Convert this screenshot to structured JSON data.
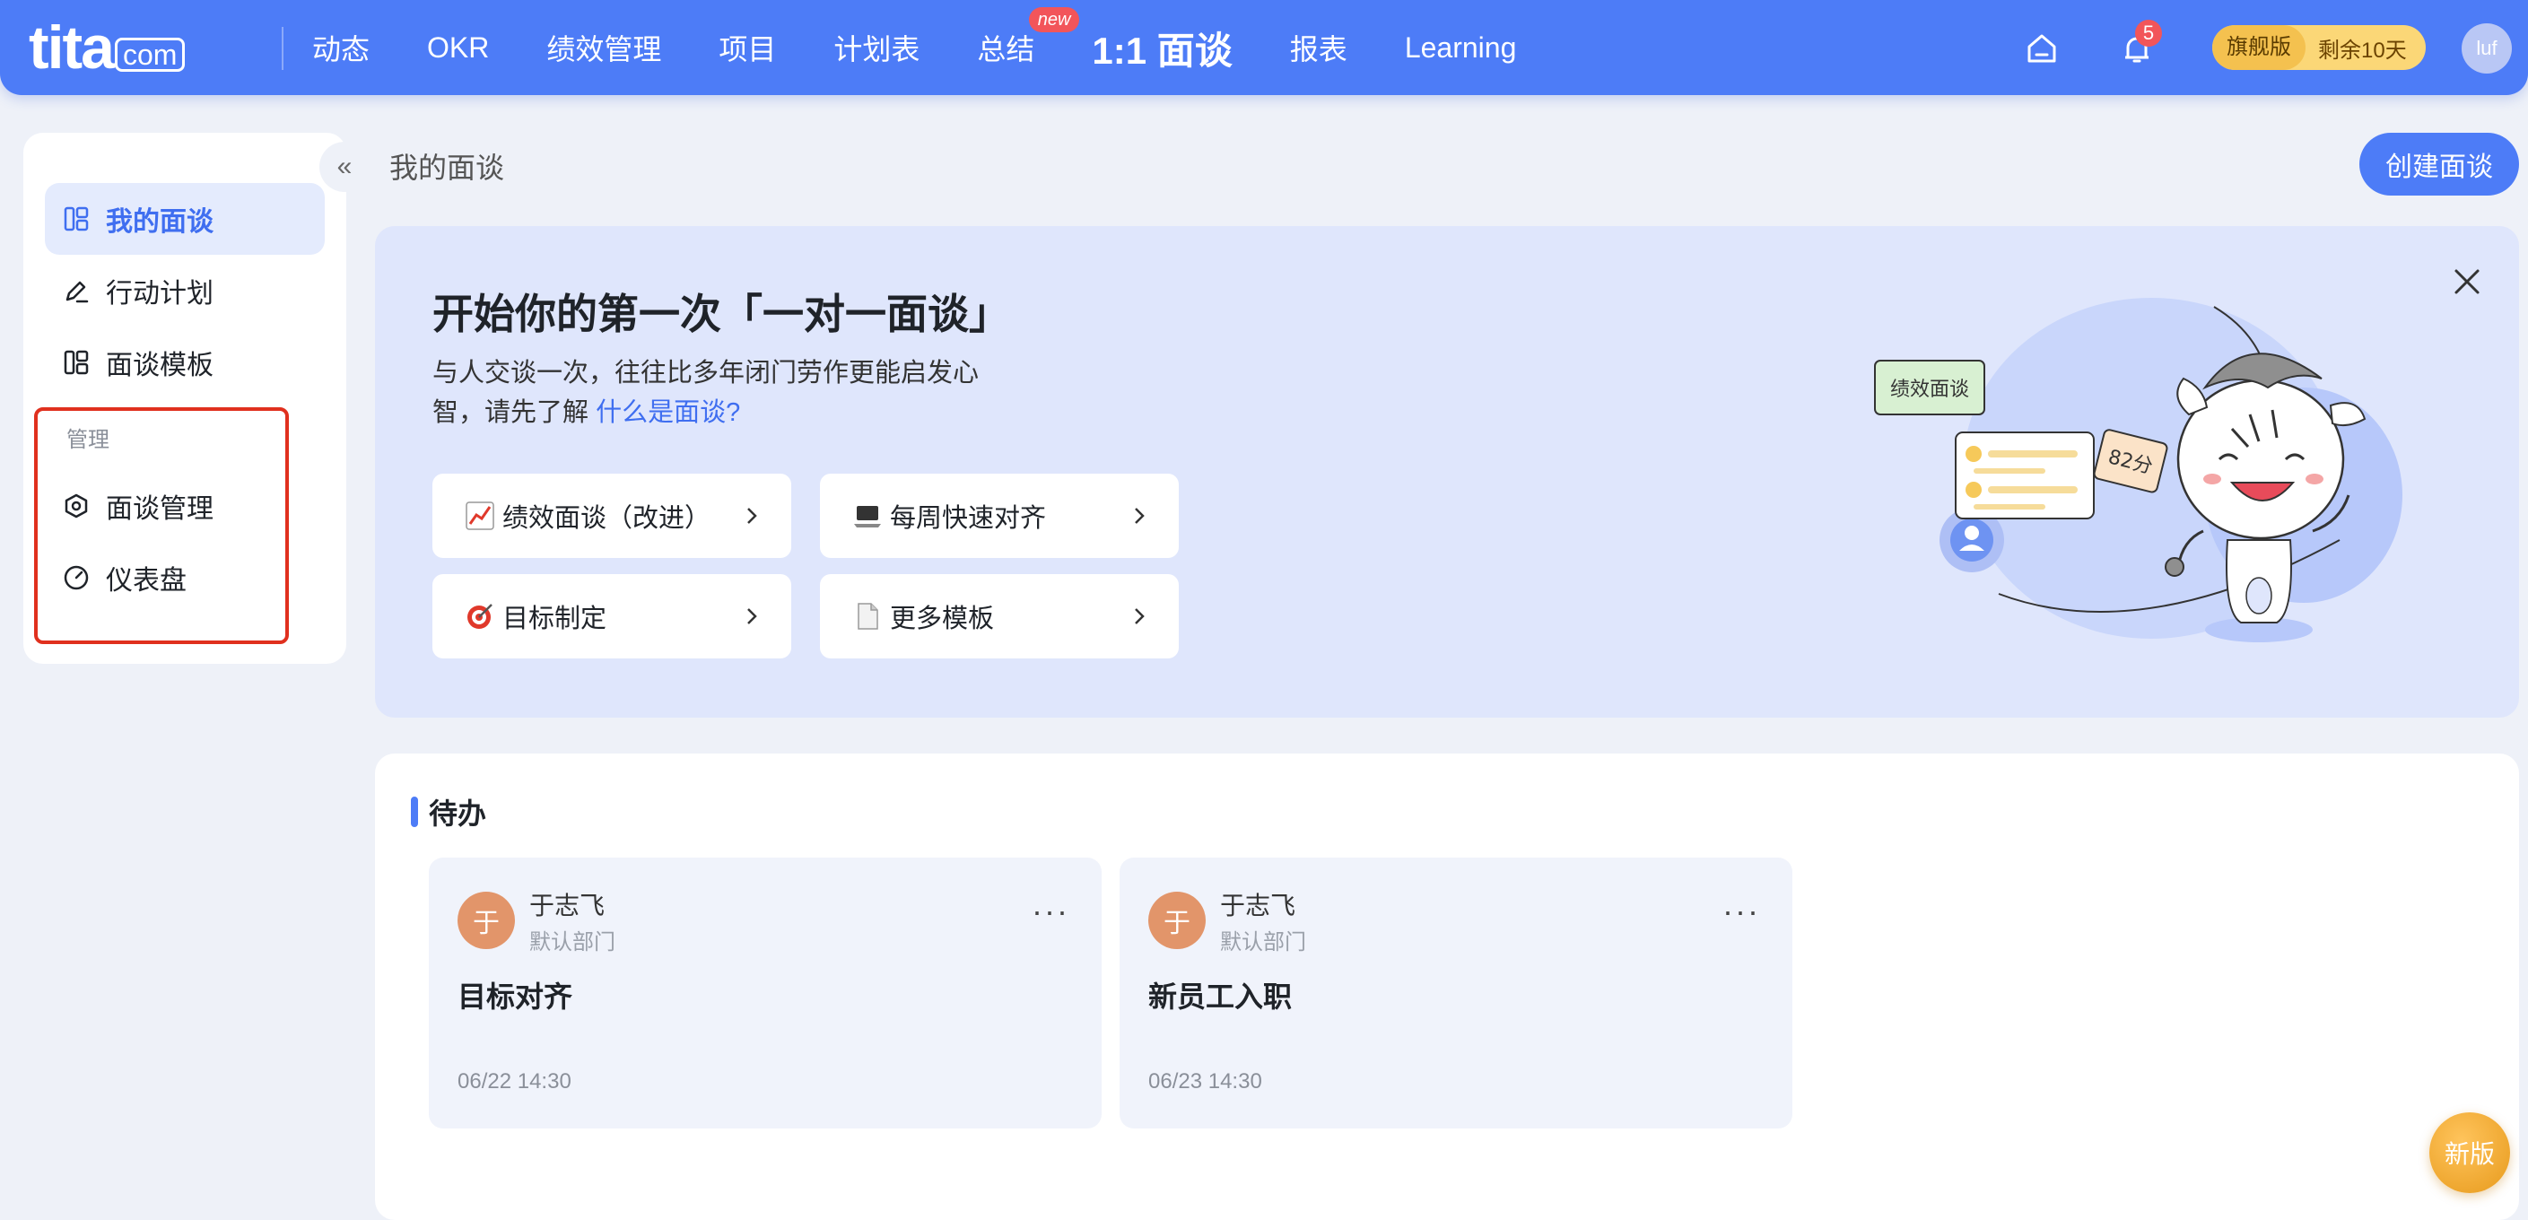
{
  "app": {
    "logo_main": "tita",
    "logo_suffix": "com"
  },
  "nav": {
    "items": [
      "动态",
      "OKR",
      "绩效管理",
      "项目",
      "计划表",
      "总结",
      "1:1 面谈",
      "报表",
      "Learning"
    ],
    "new_badge": "new",
    "notification_count": "5",
    "plan_tier": "旗舰版",
    "plan_remaining": "剩余10天",
    "user_avatar": "luf"
  },
  "sidebar": {
    "items": [
      "我的面谈",
      "行动计划",
      "面谈模板"
    ],
    "group_label": "管理",
    "manage_items": [
      "面谈管理",
      "仪表盘"
    ],
    "collapse_glyph": "«"
  },
  "main": {
    "page_title": "我的面谈",
    "create_button": "创建面谈"
  },
  "banner": {
    "title": "开始你的第一次「一对一面谈」",
    "desc_text": "与人交谈一次，往往比多年闭门劳作更能启发心智，请先了解",
    "desc_link": "什么是面谈?",
    "templates": [
      "绩效面谈（改进）",
      "每周快速对齐",
      "目标制定",
      "更多模板"
    ],
    "illus_tag": "绩效面谈",
    "illus_score": "82分"
  },
  "todo": {
    "title": "待办",
    "cards": [
      {
        "avatar": "于",
        "name": "于志飞",
        "dept": "默认部门",
        "subject": "目标对齐",
        "time": "06/22 14:30"
      },
      {
        "avatar": "于",
        "name": "于志飞",
        "dept": "默认部门",
        "subject": "新员工入职",
        "time": "06/23 14:30"
      }
    ],
    "more_glyph": "···"
  },
  "floating": {
    "new_version": "新版"
  },
  "colors": {
    "accent": "#4d7cf7",
    "highlight_box": "#e0301e",
    "plan_gold": "#fbd777"
  }
}
